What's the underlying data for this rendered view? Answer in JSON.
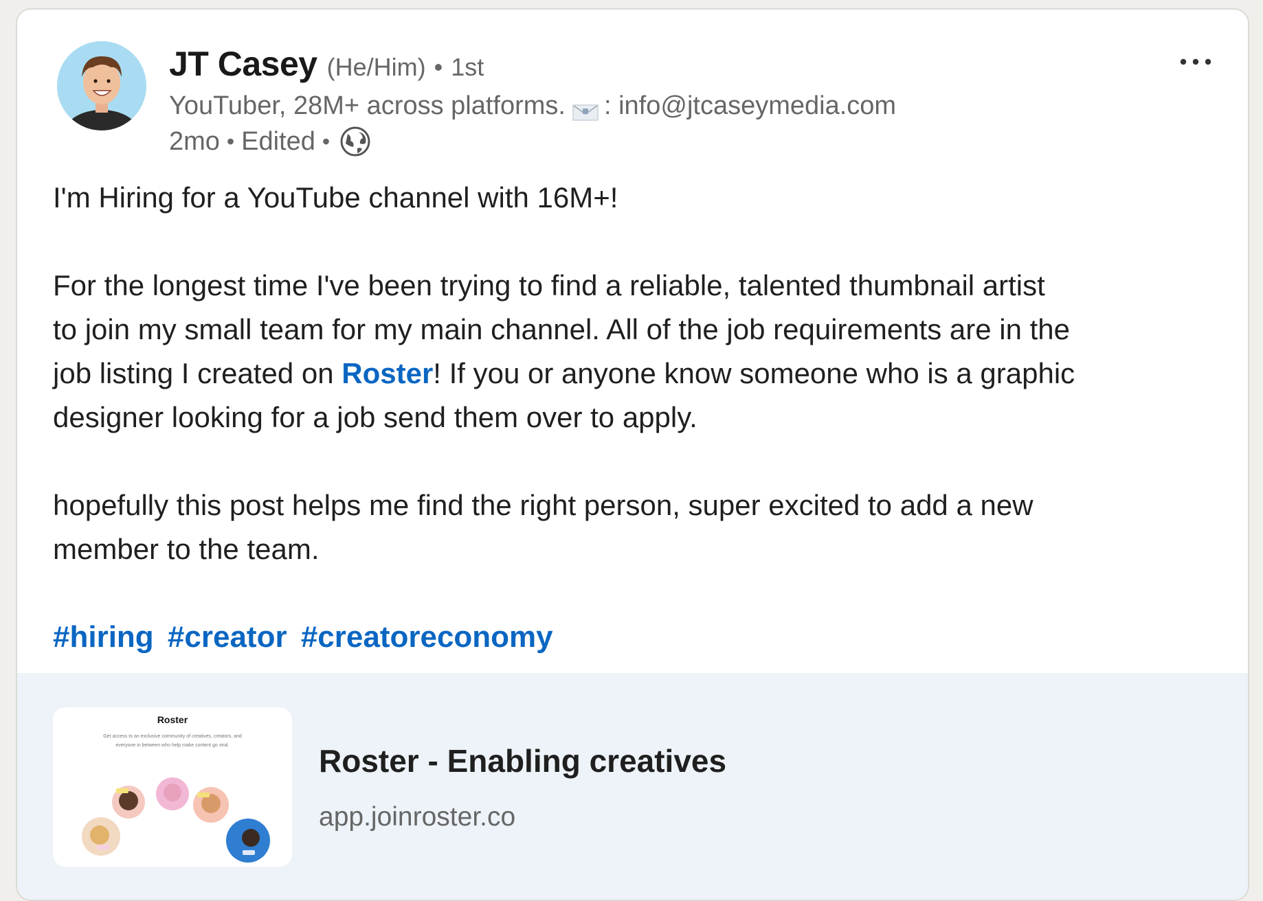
{
  "post": {
    "author": {
      "name": "JT Casey",
      "pronouns": "(He/Him)",
      "separator": "•",
      "degree": "1st",
      "headline_prefix": "YouTuber, 28M+ across platforms.",
      "headline_email": ": info@jtcaseymedia.com",
      "headline_icon": "envelope-icon",
      "avatar_icon": "avatar-photo"
    },
    "meta": {
      "time": "2mo",
      "edited": "Edited",
      "visibility_icon": "globe-icon"
    },
    "menu_icon": "more-options-icon",
    "body": {
      "line1": "I'm Hiring for a YouTube channel with 16M+!",
      "para2_line1": "For the longest time I've been trying to find a reliable, talented thumbnail artist",
      "para2_line2": "to join my small team for my main channel. All of the job requirements are in the",
      "para2_line3_before": "job listing I created on ",
      "para2_line3_link": "Roster",
      "para2_line3_after": "! If you or anyone know someone who is a graphic",
      "para2_line4": "designer looking for a job send them over to apply.",
      "para3_line1": "hopefully this post helps me find the right person, super excited to add a new",
      "para3_line2": "member to the team."
    },
    "hashtags": [
      "#hiring",
      "#creator",
      "#creatoreconomy"
    ],
    "link_preview": {
      "title": "Roster - Enabling creatives",
      "domain": "app.joinroster.co",
      "thumbnail": {
        "title": "Roster",
        "text": "Get access to an exclusive community of creatives, creators, and everyone in between who help make content go viral."
      }
    }
  },
  "colors": {
    "link": "#0a66c2",
    "preview_background": "#edf3f8",
    "secondary_text": "#666666",
    "primary_text": "#1f1f1f"
  }
}
